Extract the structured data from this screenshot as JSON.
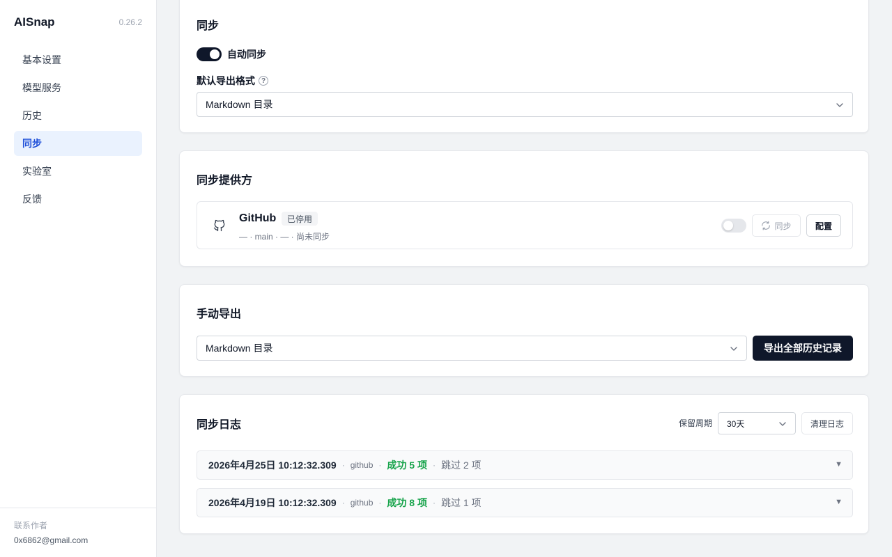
{
  "app": {
    "name": "AISnap",
    "version": "0.26.2"
  },
  "sidebar": {
    "items": [
      {
        "label": "基本设置",
        "active": false
      },
      {
        "label": "模型服务",
        "active": false
      },
      {
        "label": "历史",
        "active": false
      },
      {
        "label": "同步",
        "active": true
      },
      {
        "label": "实验室",
        "active": false
      },
      {
        "label": "反馈",
        "active": false
      }
    ],
    "footer": {
      "contact_label": "联系作者",
      "email": "0x6862@gmail.com"
    }
  },
  "sync_card": {
    "title": "同步",
    "auto_sync": {
      "label": "自动同步",
      "enabled": true
    },
    "default_format": {
      "label": "默认导出格式",
      "help_icon": "?",
      "value": "Markdown 目录"
    }
  },
  "providers_card": {
    "title": "同步提供方",
    "provider": {
      "icon": "github-icon",
      "name": "GitHub",
      "status_badge": "已停用",
      "meta": "— · main · — · 尚未同步",
      "enabled": false,
      "sync_button": "同步",
      "config_button": "配置"
    }
  },
  "manual_export_card": {
    "title": "手动导出",
    "format_value": "Markdown 目录",
    "export_button": "导出全部历史记录"
  },
  "log_card": {
    "title": "同步日志",
    "retention_label": "保留周期",
    "retention_value": "30天",
    "clear_button": "清理日志",
    "entries": [
      {
        "date": "2026年4月25日 10:12:32.309",
        "provider": "github",
        "success": "成功 5 项",
        "skipped": "跳过 2 项"
      },
      {
        "date": "2026年4月19日 10:12:32.309",
        "provider": "github",
        "success": "成功 8 项",
        "skipped": "跳过 1 项"
      }
    ]
  },
  "colors": {
    "accent": "#0f172a",
    "active_nav_bg": "#eaf2fe",
    "active_nav_text": "#1d4ed8",
    "success": "#16a34a"
  }
}
